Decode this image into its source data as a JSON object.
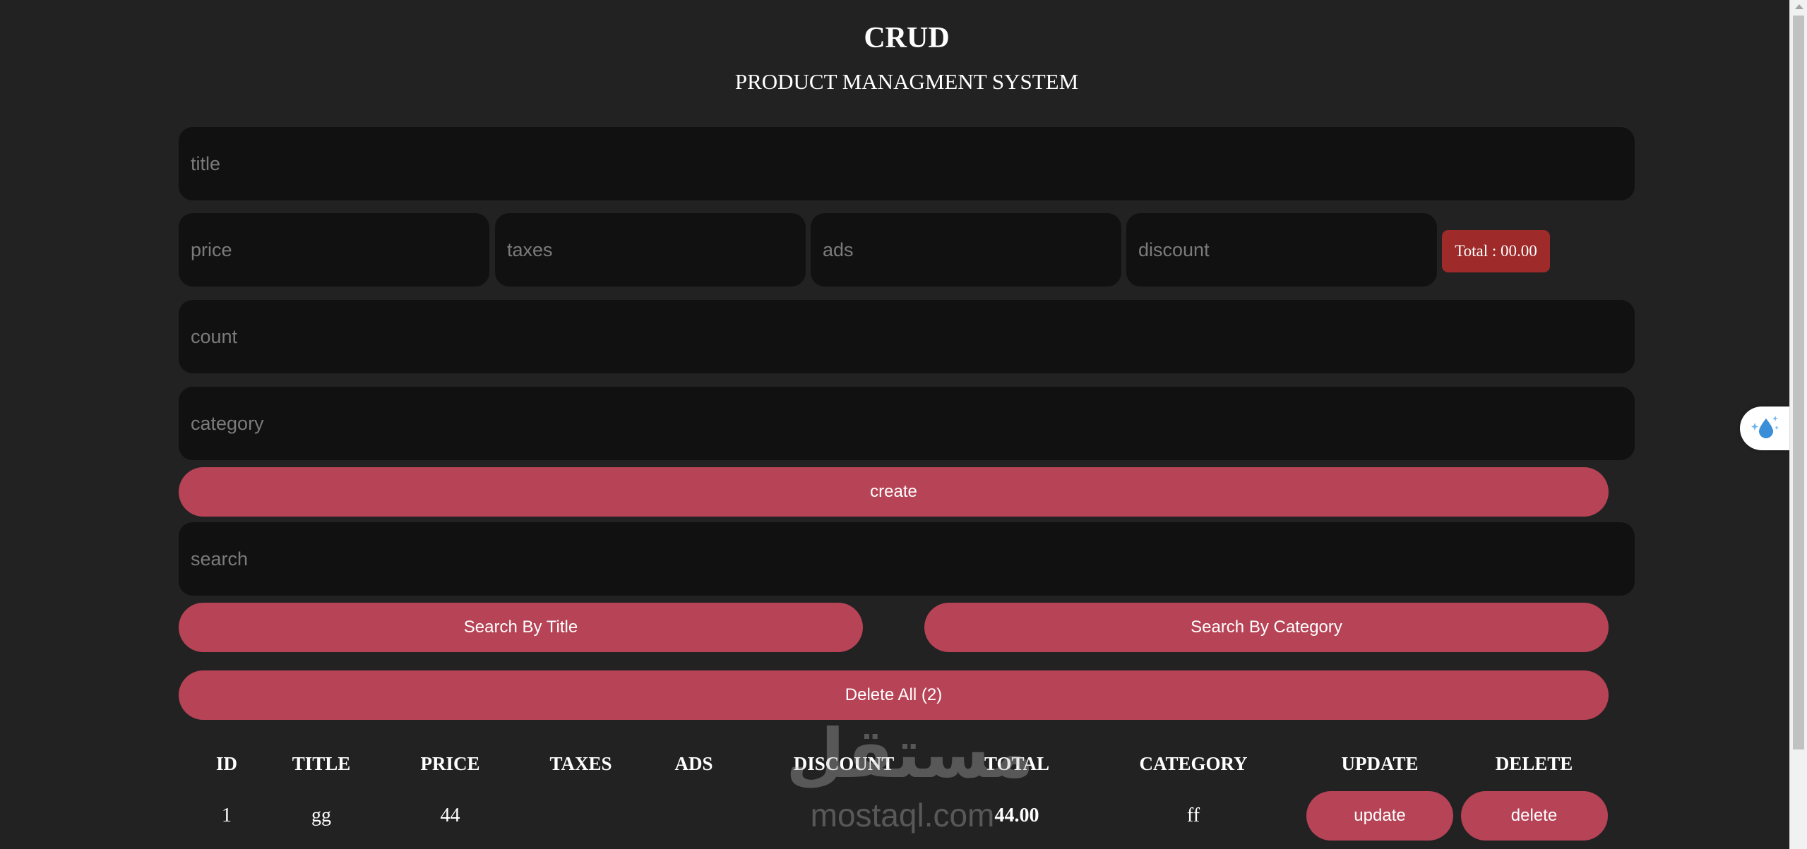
{
  "header": {
    "title": "CRUD",
    "subtitle": "PRODUCT MANAGMENT SYSTEM"
  },
  "form": {
    "title_placeholder": "title",
    "price_placeholder": "price",
    "taxes_placeholder": "taxes",
    "ads_placeholder": "ads",
    "discount_placeholder": "discount",
    "total_label": "Total : 00.00",
    "count_placeholder": "count",
    "category_placeholder": "category",
    "create_label": "create"
  },
  "search": {
    "placeholder": "search",
    "by_title_label": "Search By Title",
    "by_category_label": "Search By Category"
  },
  "delete_all_label": "Delete All (2)",
  "table": {
    "headers": [
      "ID",
      "TITLE",
      "PRICE",
      "TAXES",
      "ADS",
      "DISCOUNT",
      "TOTAL",
      "CATEGORY",
      "UPDATE",
      "DELETE"
    ],
    "rows": [
      {
        "id": "1",
        "title": "gg",
        "price": "44",
        "taxes": "",
        "ads": "",
        "discount": "",
        "total": "44.00",
        "category": "ff",
        "update_label": "update",
        "delete_label": "delete"
      }
    ]
  },
  "watermark": {
    "arabic": "مستقل",
    "latin": "mostaql.com"
  },
  "icons": {
    "widget": "water-drop-sparkle-icon"
  },
  "colors": {
    "background": "#222222",
    "input_bg": "#111111",
    "accent": "#b64356",
    "total_badge": "#9e2a2a"
  }
}
